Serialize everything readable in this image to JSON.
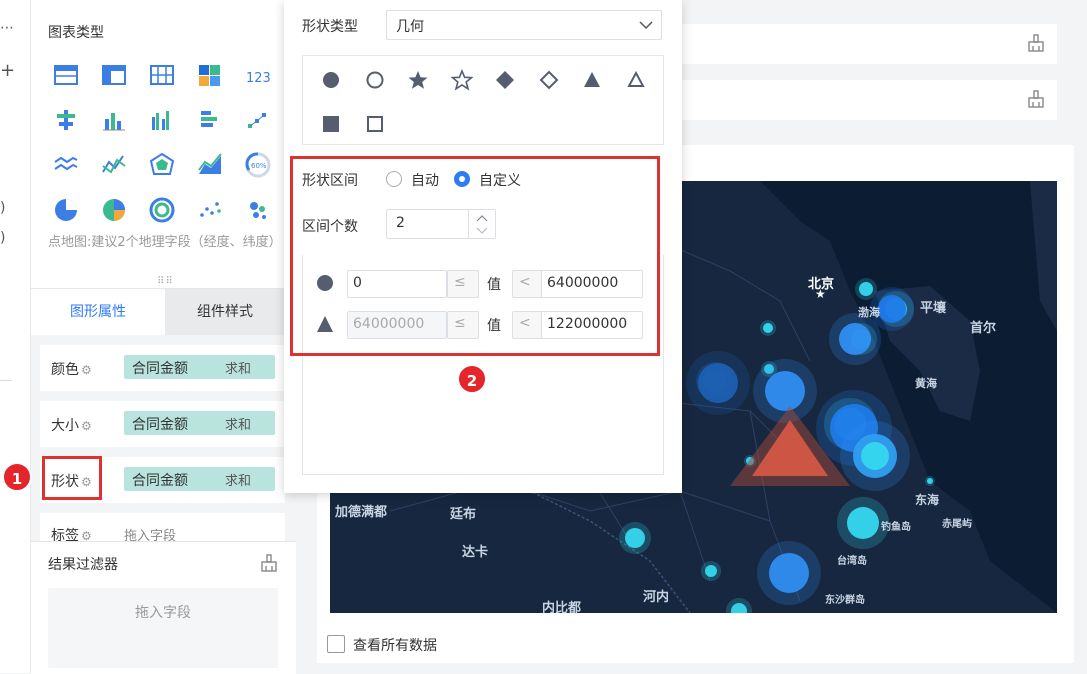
{
  "chart_type_panel": {
    "title": "图表类型",
    "hint": "点地图:建议2个地理字段（经度、纬度）",
    "icons": [
      "table-icon",
      "cross-table-icon",
      "detail-table-icon",
      "treemap-icon",
      "number-card-icon",
      "stacked-bar-icon",
      "bar-icon",
      "grouped-bar-icon",
      "stacked-horizontal-bar-icon",
      "scatter-line-icon",
      "area-line-icon",
      "line-icon",
      "radar-icon",
      "area-icon",
      "gauge-icon",
      "pie-icon",
      "rose-pie-icon",
      "multi-pie-icon",
      "scatter-icon",
      "bubble-icon"
    ],
    "accent_color": "#3d7ee6"
  },
  "tabs": {
    "graphic": "图形属性",
    "component": "组件样式"
  },
  "attributes": {
    "color": {
      "label": "颜色",
      "field": "合同金额",
      "agg": "求和"
    },
    "size": {
      "label": "大小",
      "field": "合同金额",
      "agg": "求和"
    },
    "shape": {
      "label": "形状",
      "field": "合同金额",
      "agg": "求和"
    },
    "label": {
      "label": "标签",
      "hint": "拖入字段"
    }
  },
  "filter": {
    "title": "结果过滤器",
    "drop_hint": "拖入字段"
  },
  "main": {
    "view_all": "查看所有数据"
  },
  "popup": {
    "shape_type_label": "形状类型",
    "shape_type_value": "几何",
    "shapes": [
      "filled-circle-icon",
      "hollow-circle-icon",
      "filled-star-icon",
      "hollow-star-icon",
      "filled-diamond-icon",
      "hollow-diamond-icon",
      "filled-triangle-icon",
      "hollow-triangle-icon",
      "filled-square-icon",
      "hollow-square-icon"
    ],
    "range_label": "形状区间",
    "radio_auto": "自动",
    "radio_custom": "自定义",
    "radio_selected": "自定义",
    "interval_count_label": "区间个数",
    "interval_count": "2",
    "ranges": [
      {
        "shape": "filled-circle-icon",
        "from": "0",
        "to": "64000000",
        "value_label": "值",
        "op_from": "≤",
        "op_to": "<"
      },
      {
        "shape": "filled-triangle-icon",
        "from": "64000000",
        "to": "122000000",
        "value_label": "值",
        "op_from": "≤",
        "op_to": "<"
      }
    ]
  },
  "map_labels": {
    "beijing": "北京",
    "bohai": "渤海",
    "pingrang": "平壤",
    "seoul": "首尔",
    "yellow_sea": "黄海",
    "east_sea": "东海",
    "diaoyu": "钓鱼岛",
    "ryukyu": "赤尾屿",
    "taiwan": "台湾岛",
    "dongsha": "东沙群岛",
    "kathmandu": "加德满都",
    "thimphu": "廷布",
    "dhaka": "达卡",
    "naypyidaw": "内比都",
    "hanoi": "河内"
  },
  "annotations": {
    "badge1": "1",
    "badge2": "2"
  },
  "colors": {
    "primary": "#2f7bf5",
    "annotation_red": "#e03131",
    "pill": "#b9e4dd",
    "map_bg": "#0b1c33"
  }
}
